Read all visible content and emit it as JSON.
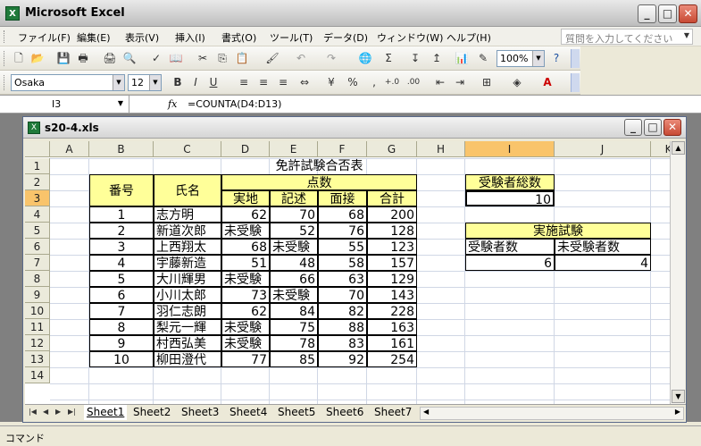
{
  "app": {
    "title": "Microsoft Excel",
    "icon_text": "X"
  },
  "window_buttons": [
    "_",
    "□",
    "✕"
  ],
  "menubar": {
    "items": [
      "ファイル(F)",
      "編集(E)",
      "表示(V)",
      "挿入(I)",
      "書式(O)",
      "ツール(T)",
      "データ(D)",
      "ウィンドウ(W)",
      "ヘルプ(H)"
    ],
    "ask_placeholder": "質問を入力してください"
  },
  "toolbar1": {
    "zoom": "100%"
  },
  "toolbar2": {
    "font": "Osaka",
    "size": "12"
  },
  "formula_bar": {
    "name_box": "I3",
    "fx": "fx",
    "formula": "=COUNTA(D4:D13)"
  },
  "workbook": {
    "title": "s20-4.xls",
    "icon_text": "X"
  },
  "columns": [
    "A",
    "B",
    "C",
    "D",
    "E",
    "F",
    "G",
    "H",
    "I",
    "J",
    "K"
  ],
  "rows": [
    "1",
    "2",
    "3",
    "4",
    "5",
    "6",
    "7",
    "8",
    "9",
    "10",
    "11",
    "12",
    "13",
    "14"
  ],
  "selected_col": "I",
  "selected_row": "3",
  "sheet": {
    "title": "免許試験合否表",
    "hdr_no": "番号",
    "hdr_name": "氏名",
    "hdr_points": "点数",
    "hdr_sub": [
      "実地",
      "記述",
      "面接",
      "合計"
    ],
    "data": [
      [
        "1",
        "志方明",
        "62",
        "70",
        "68",
        "200"
      ],
      [
        "2",
        "新道次郎",
        "未受験",
        "52",
        "76",
        "128"
      ],
      [
        "3",
        "上西翔太",
        "68",
        "未受験",
        "55",
        "123"
      ],
      [
        "4",
        "宇藤新造",
        "51",
        "48",
        "58",
        "157"
      ],
      [
        "5",
        "大川輝男",
        "未受験",
        "66",
        "63",
        "129"
      ],
      [
        "6",
        "小川太郎",
        "73",
        "未受験",
        "70",
        "143"
      ],
      [
        "7",
        "羽仁志朗",
        "62",
        "84",
        "82",
        "228"
      ],
      [
        "8",
        "梨元一輝",
        "未受験",
        "75",
        "88",
        "163"
      ],
      [
        "9",
        "村西弘美",
        "未受験",
        "78",
        "83",
        "161"
      ],
      [
        "10",
        "柳田澄代",
        "77",
        "85",
        "92",
        "254"
      ]
    ],
    "total_label": "受験者総数",
    "total_value": "10",
    "exam_label": "実施試験",
    "exam_taken_label": "受験者数",
    "exam_not_label": "未受験者数",
    "exam_taken": "6",
    "exam_not": "4"
  },
  "sheet_tabs": [
    "Sheet1",
    "Sheet2",
    "Sheet3",
    "Sheet4",
    "Sheet5",
    "Sheet6",
    "Sheet7"
  ],
  "status": "コマンド"
}
